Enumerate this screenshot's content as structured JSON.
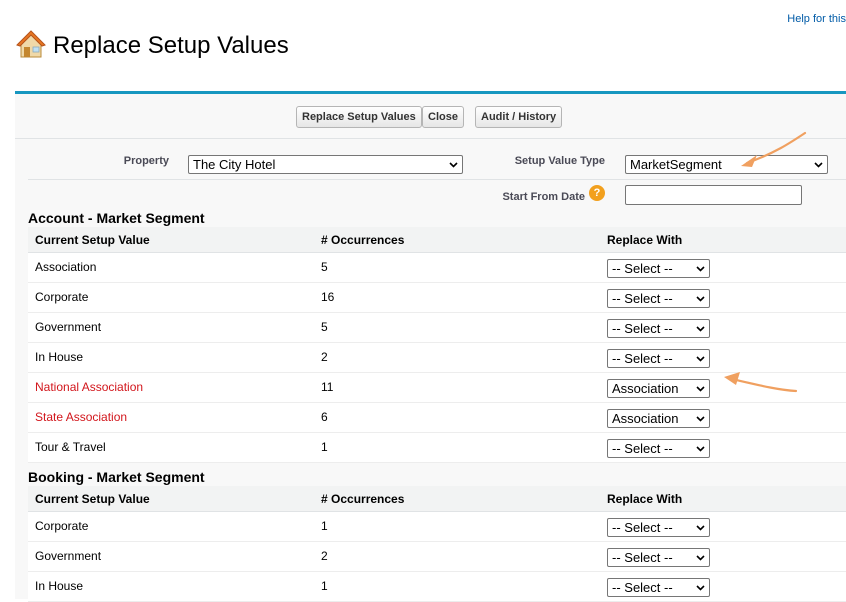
{
  "header": {
    "help_link": "Help for this",
    "title": "Replace Setup Values"
  },
  "toolbar": {
    "replace_label": "Replace Setup Values",
    "close_label": "Close",
    "audit_label": "Audit / History"
  },
  "form": {
    "property_label": "Property",
    "property_value": "The City Hotel",
    "setup_value_type_label": "Setup Value Type",
    "setup_value_type_value": "MarketSegment",
    "start_from_date_label": "Start From Date",
    "start_from_date_value": "",
    "help_icon_glyph": "?"
  },
  "sections": [
    {
      "title": "Account - Market Segment",
      "columns": [
        "Current Setup Value",
        "# Occurrences",
        "Replace With"
      ],
      "rows": [
        {
          "value": "Association",
          "occurrences": "5",
          "replace_with": "-- Select --",
          "highlight": false
        },
        {
          "value": "Corporate",
          "occurrences": "16",
          "replace_with": "-- Select --",
          "highlight": false
        },
        {
          "value": "Government",
          "occurrences": "5",
          "replace_with": "-- Select --",
          "highlight": false
        },
        {
          "value": "In House",
          "occurrences": "2",
          "replace_with": "-- Select --",
          "highlight": false
        },
        {
          "value": "National Association",
          "occurrences": "11",
          "replace_with": "Association",
          "highlight": true
        },
        {
          "value": "State Association",
          "occurrences": "6",
          "replace_with": "Association",
          "highlight": true
        },
        {
          "value": "Tour & Travel",
          "occurrences": "1",
          "replace_with": "-- Select --",
          "highlight": false
        }
      ]
    },
    {
      "title": "Booking - Market Segment",
      "columns": [
        "Current Setup Value",
        "# Occurrences",
        "Replace With"
      ],
      "rows": [
        {
          "value": "Corporate",
          "occurrences": "1",
          "replace_with": "-- Select --",
          "highlight": false
        },
        {
          "value": "Government",
          "occurrences": "2",
          "replace_with": "-- Select --",
          "highlight": false
        },
        {
          "value": "In House",
          "occurrences": "1",
          "replace_with": "-- Select --",
          "highlight": false
        }
      ]
    }
  ],
  "colors": {
    "accent_border": "#1797c0",
    "highlight_text": "#d2161c",
    "annotation_arrow": "#f0a060"
  },
  "icons": {
    "page_icon": "house-icon",
    "select_chevron": "chevron-down-icon",
    "help_icon": "question-icon"
  }
}
